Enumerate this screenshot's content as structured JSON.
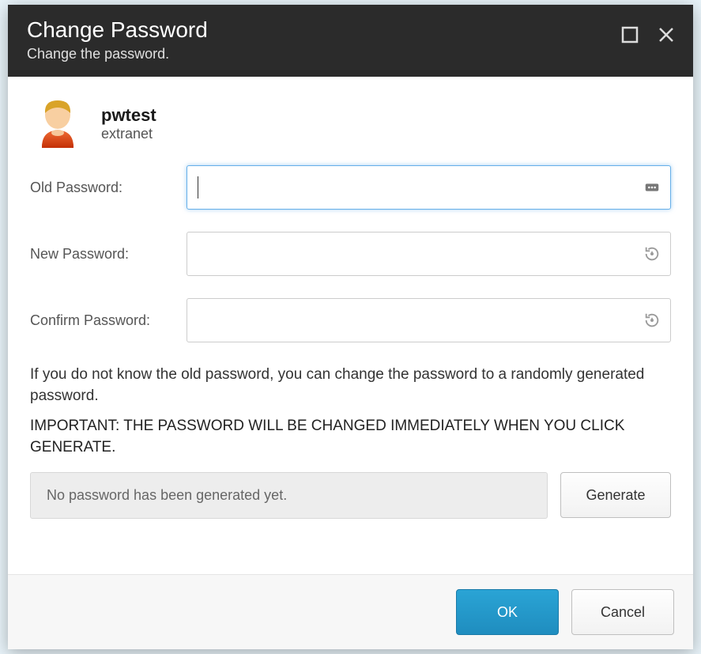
{
  "header": {
    "title": "Change Password",
    "subtitle": "Change the password."
  },
  "user": {
    "name": "pwtest",
    "domain": "extranet"
  },
  "form": {
    "old_label": "Old Password:",
    "new_label": "New Password:",
    "confirm_label": "Confirm Password:",
    "old_value": "",
    "new_value": "",
    "confirm_value": ""
  },
  "info": {
    "help": "If you do not know the old password, you can change the password to a randomly generated password.",
    "warning": "IMPORTANT: THE PASSWORD WILL BE CHANGED IMMEDIATELY WHEN YOU CLICK GENERATE."
  },
  "generate": {
    "status": "No password has been generated yet.",
    "button": "Generate"
  },
  "footer": {
    "ok": "OK",
    "cancel": "Cancel"
  }
}
